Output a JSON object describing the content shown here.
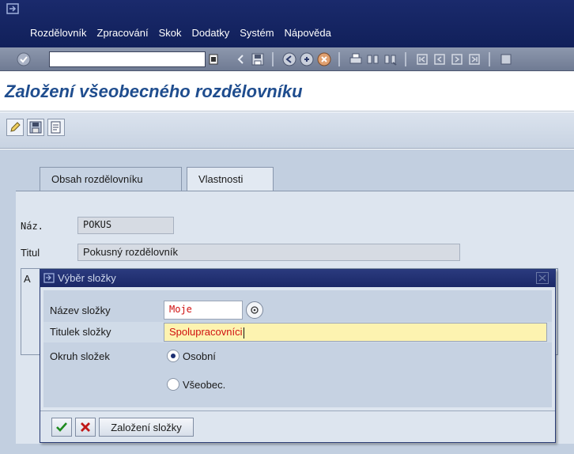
{
  "menu": {
    "items": [
      {
        "label": "Rozdělovník"
      },
      {
        "label": "Zpracování"
      },
      {
        "label": "Skok"
      },
      {
        "label": "Dodatky"
      },
      {
        "label": "Systém"
      },
      {
        "label": "Nápověda"
      }
    ]
  },
  "toolbar": {
    "command_value": "",
    "icons": [
      "enter-icon",
      "back-icon",
      "save-icon",
      "back-nav-icon",
      "exit-icon",
      "cancel-icon",
      "print-icon",
      "find-icon",
      "find-next-icon",
      "first-page-icon",
      "previous-page-icon",
      "next-page-icon",
      "last-page-icon"
    ]
  },
  "header": {
    "title": "Založení všeobecného rozdělovníku"
  },
  "app_toolbar": {
    "icons": [
      "edit-icon",
      "save-local-icon",
      "display-icon"
    ]
  },
  "tabs": [
    {
      "label": "Obsah rozdělovníku",
      "active": false
    },
    {
      "label": "Vlastnosti",
      "active": true
    }
  ],
  "form": {
    "name_label": "Náz.",
    "name_value": "POKUS",
    "title_label": "Titul",
    "title_value": "Pokusný rozdělovník",
    "hidden_label_letter": "A"
  },
  "dialog": {
    "title": "Výběr složky",
    "folder_name_label": "Název složky",
    "folder_name_value": "Moje",
    "folder_title_label": "Titulek složky",
    "folder_title_value": "Spolupracovníci",
    "scope_label": "Okruh složek",
    "options": [
      {
        "label": "Osobní",
        "selected": true
      },
      {
        "label": "Všeobec.",
        "selected": false
      }
    ],
    "create_button": "Založení složky"
  },
  "colors": {
    "menubar": "#1a2a6c",
    "title_text": "#1f4d8e",
    "input_text": "#d01010",
    "focus_field": "#fdf3b0",
    "confirm_green": "#1e8a1e",
    "cancel_red": "#c01818"
  }
}
